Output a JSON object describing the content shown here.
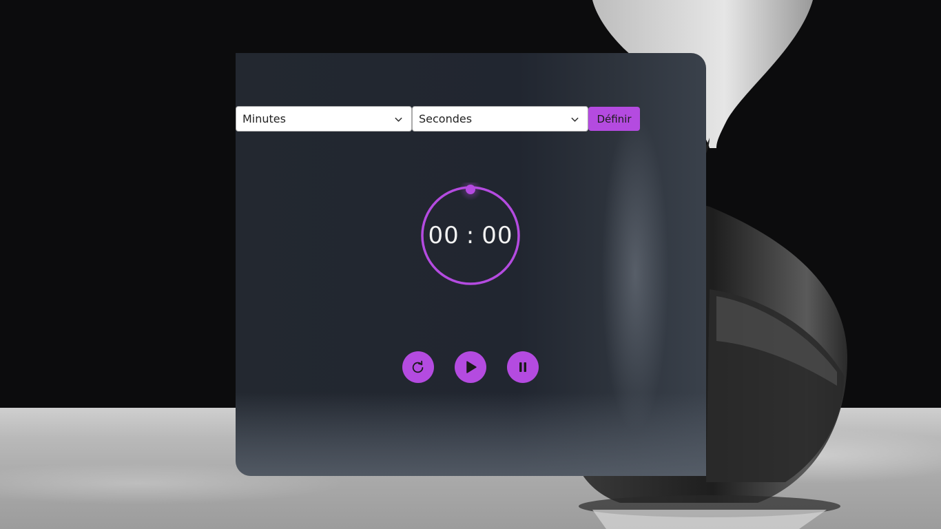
{
  "timer": {
    "minutes_select": {
      "selected": "Minutes"
    },
    "seconds_select": {
      "selected": "Secondes"
    },
    "set_button": "Définir",
    "display": {
      "minutes": "00",
      "separator": ":",
      "seconds": "00"
    },
    "actions": [
      {
        "name": "reset",
        "icon": "reset-icon"
      },
      {
        "name": "play",
        "icon": "play-icon"
      },
      {
        "name": "pause",
        "icon": "pause-icon"
      }
    ],
    "progress_fraction": 1.0
  },
  "colors": {
    "accent": "#b44be0",
    "card_bg": "#212630",
    "time_text": "#f2f2f2"
  }
}
